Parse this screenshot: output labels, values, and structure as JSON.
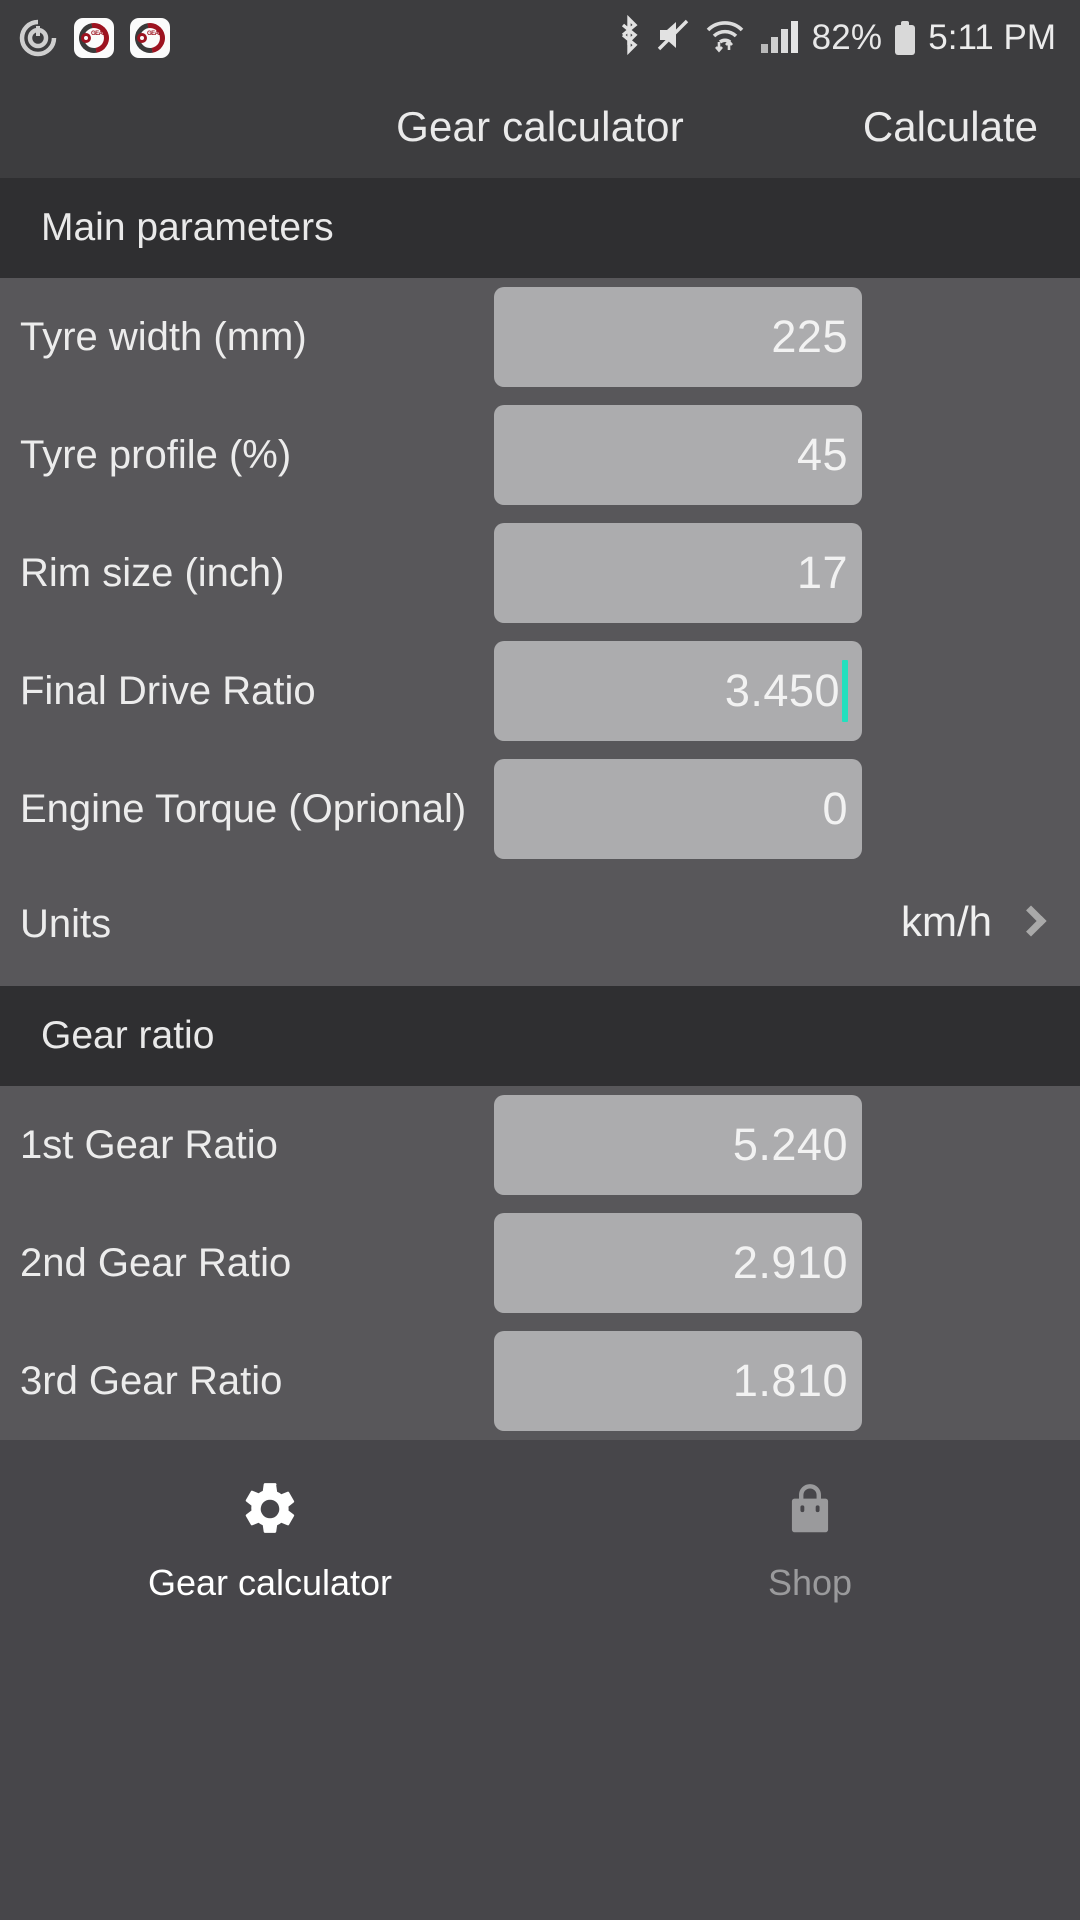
{
  "statusbar": {
    "icons_left": [
      "power-ring-icon",
      "app-notification-icon",
      "app-notification-icon"
    ],
    "bluetooth": "bluetooth-icon",
    "mute": "mute-icon",
    "wifi": "wifi-icon",
    "signal": "signal-bars-icon",
    "battery_percent": "82%",
    "battery": "battery-icon",
    "time": "5:11 PM"
  },
  "titlebar": {
    "title": "Gear calculator",
    "action": "Calculate"
  },
  "sections": {
    "main_parameters": "Main parameters",
    "gear_ratio": "Gear ratio"
  },
  "main_parameters": [
    {
      "label": "Tyre width (mm)",
      "value": "225",
      "caret": false
    },
    {
      "label": "Tyre profile (%)",
      "value": "45",
      "caret": false
    },
    {
      "label": "Rim size (inch)",
      "value": "17",
      "caret": false
    },
    {
      "label": "Final Drive Ratio",
      "value": "3.450",
      "caret": true
    },
    {
      "label": "Engine Torque (Oprional)",
      "value": "0",
      "caret": false
    }
  ],
  "units_row": {
    "label": "Units",
    "value": "km/h",
    "chevron": "chevron-right-icon"
  },
  "gear_ratios": [
    {
      "label": "1st Gear Ratio",
      "value": "5.240"
    },
    {
      "label": "2nd Gear Ratio",
      "value": "2.910"
    },
    {
      "label": "3rd Gear Ratio",
      "value": "1.810"
    }
  ],
  "bottom_nav": [
    {
      "label": "Gear calculator",
      "icon": "gear-icon",
      "active": true
    },
    {
      "label": "Shop",
      "icon": "shopping-bag-icon",
      "active": false
    }
  ],
  "colors": {
    "status_bar_bg": "#3D3D3F",
    "section_bg": "#2F2F31",
    "body_bg": "#58575A",
    "field_bg": "#ACACAE",
    "caret": "#22E0BE",
    "nav_bg": "#47464A",
    "text_primary": "#ECECEC",
    "text_inactive": "#9A9A9C"
  }
}
